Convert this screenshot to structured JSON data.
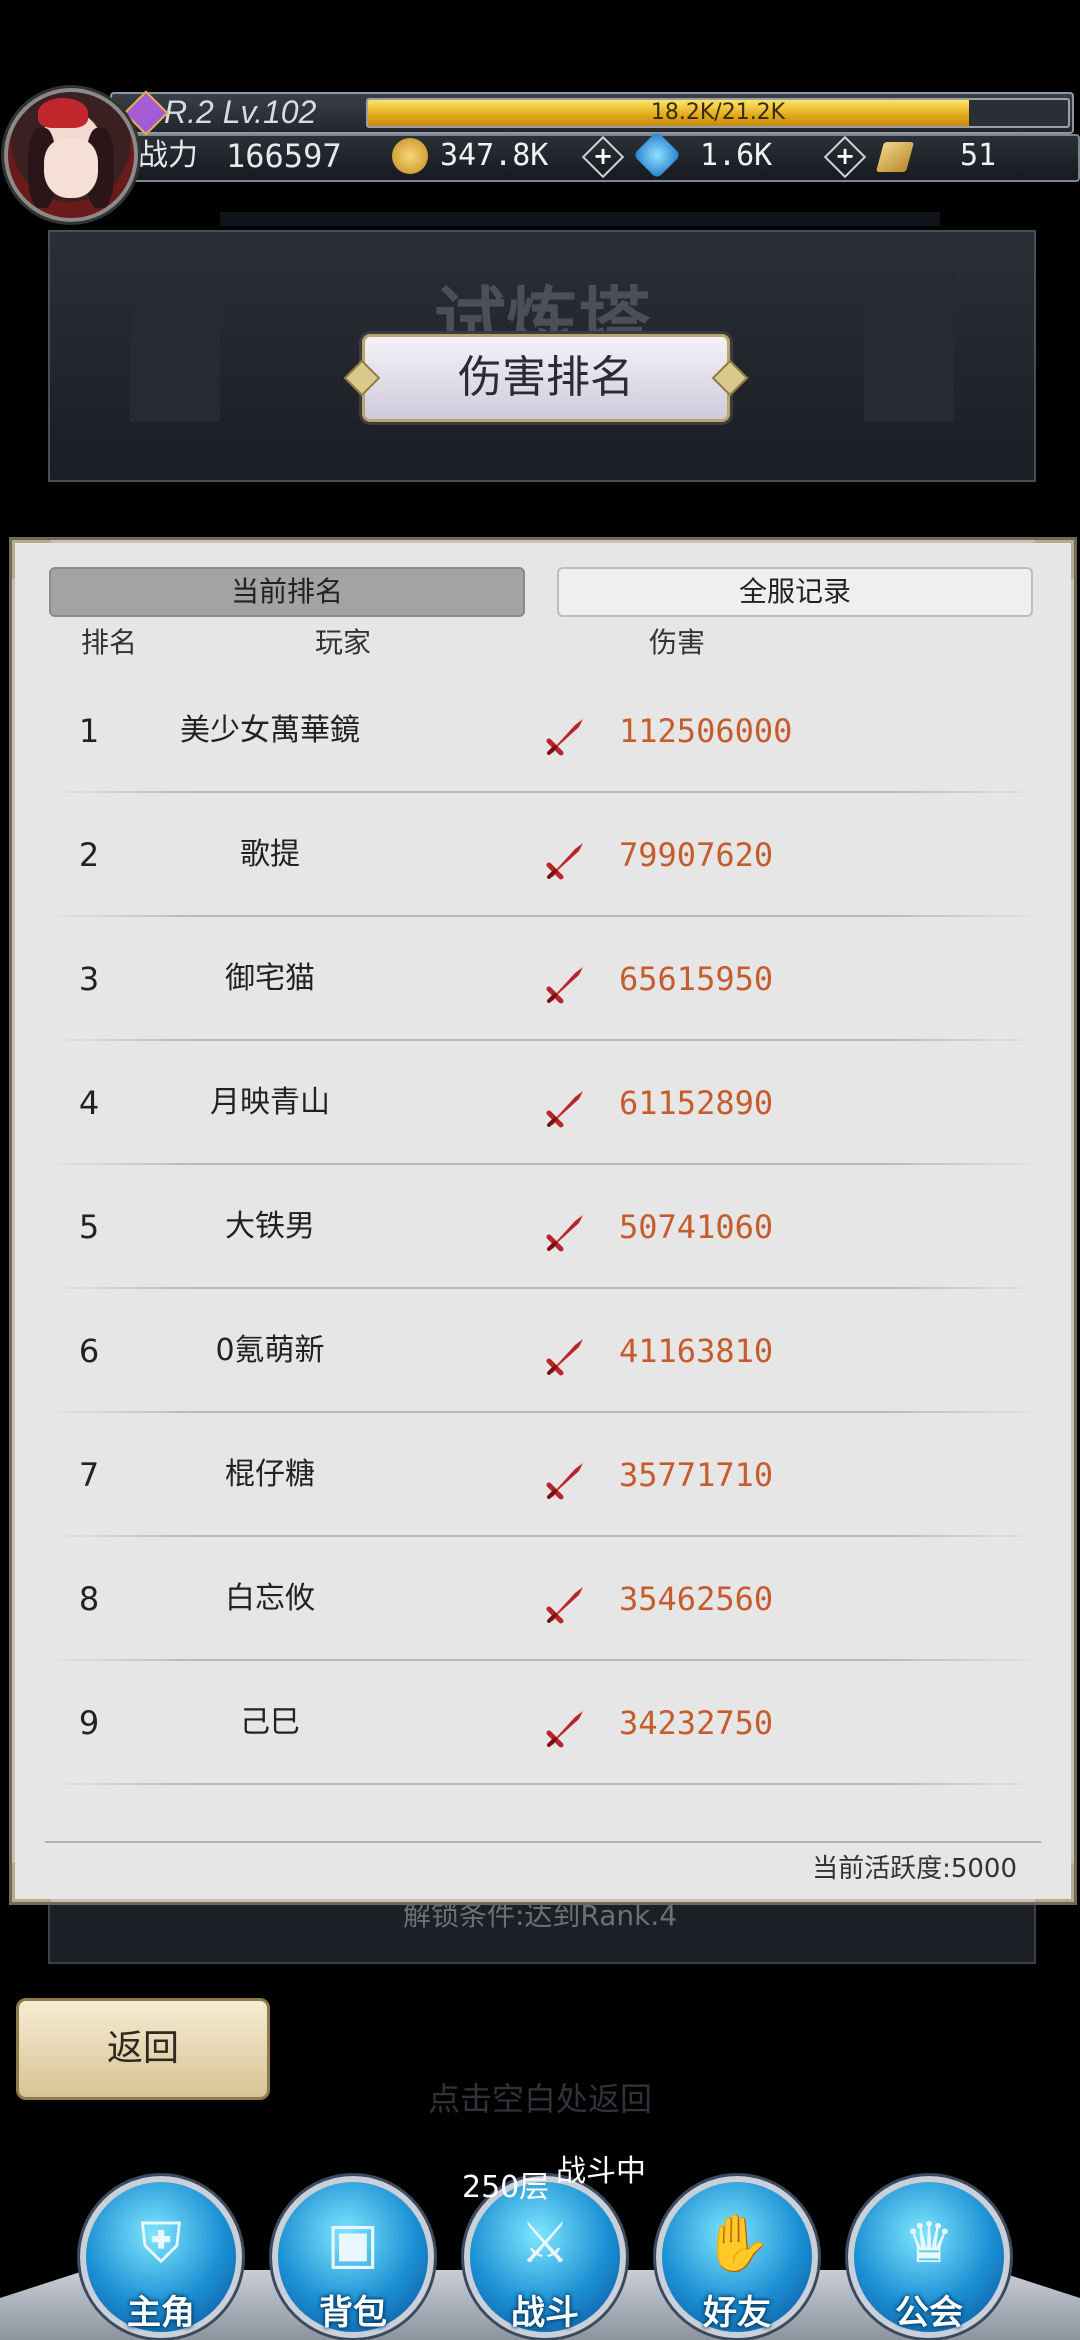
{
  "header": {
    "rank_level": "R.2 Lv.102",
    "exp_text": "18.2K/21.2K",
    "exp_fraction": 0.858,
    "power_label": "战力",
    "power_value": "166597",
    "gold": "347.8K",
    "gems": "1.6K",
    "tickets": "51"
  },
  "background": {
    "scene_title": "试炼塔",
    "unlock_condition": "解锁条件:达到Rank.4",
    "tap_hint": "点击空白处返回"
  },
  "panel": {
    "title": "伤害排名",
    "tabs": [
      "当前排名",
      "全服记录"
    ],
    "columns": [
      "排名",
      "玩家",
      "伤害"
    ],
    "rows": [
      {
        "rank": "1",
        "name": "美少女萬華鏡",
        "damage": "112506000"
      },
      {
        "rank": "2",
        "name": "歌提",
        "damage": "79907620"
      },
      {
        "rank": "3",
        "name": "御宅猫",
        "damage": "65615950"
      },
      {
        "rank": "4",
        "name": "月映青山",
        "damage": "61152890"
      },
      {
        "rank": "5",
        "name": "大铁男",
        "damage": "50741060"
      },
      {
        "rank": "6",
        "name": "0氪萌新",
        "damage": "41163810"
      },
      {
        "rank": "7",
        "name": "棍仔糖",
        "damage": "35771710"
      },
      {
        "rank": "8",
        "name": "白忘攸",
        "damage": "35462560"
      },
      {
        "rank": "9",
        "name": "己巳",
        "damage": "34232750"
      }
    ],
    "activity": "当前活跃度:5000"
  },
  "back_button": "返回",
  "bottom_nav": {
    "floor": "250层",
    "status": "战斗中",
    "items": [
      "主角",
      "背包",
      "战斗",
      "好友",
      "公会"
    ]
  },
  "colors": {
    "damage_text": "#c65b2c",
    "sword_icon": "#b8252a",
    "nav_button": "#1b8fd3"
  }
}
